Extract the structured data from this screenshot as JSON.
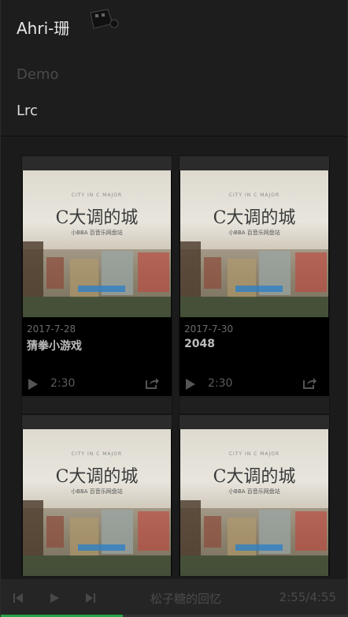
{
  "header": {
    "brand": "Ahri-珊",
    "nav": [
      {
        "label": "Demo"
      },
      {
        "label": "Lrc"
      }
    ]
  },
  "cover": {
    "subtitle": "CITY IN C MAJOR",
    "title": "C大调的城",
    "caption": "小BBA 百音乐网盘站"
  },
  "cards": [
    {
      "date": "2017-7-28",
      "title": "猜拳小游戏",
      "duration": "2:30"
    },
    {
      "date": "2017-7-30",
      "title": "2048",
      "duration": "2:30"
    },
    {
      "date": "",
      "title": "",
      "duration": ""
    },
    {
      "date": "",
      "title": "",
      "duration": ""
    }
  ],
  "player": {
    "now_playing": "松子糖的回忆",
    "time": "2:55/4:55",
    "progress": 0.35
  }
}
